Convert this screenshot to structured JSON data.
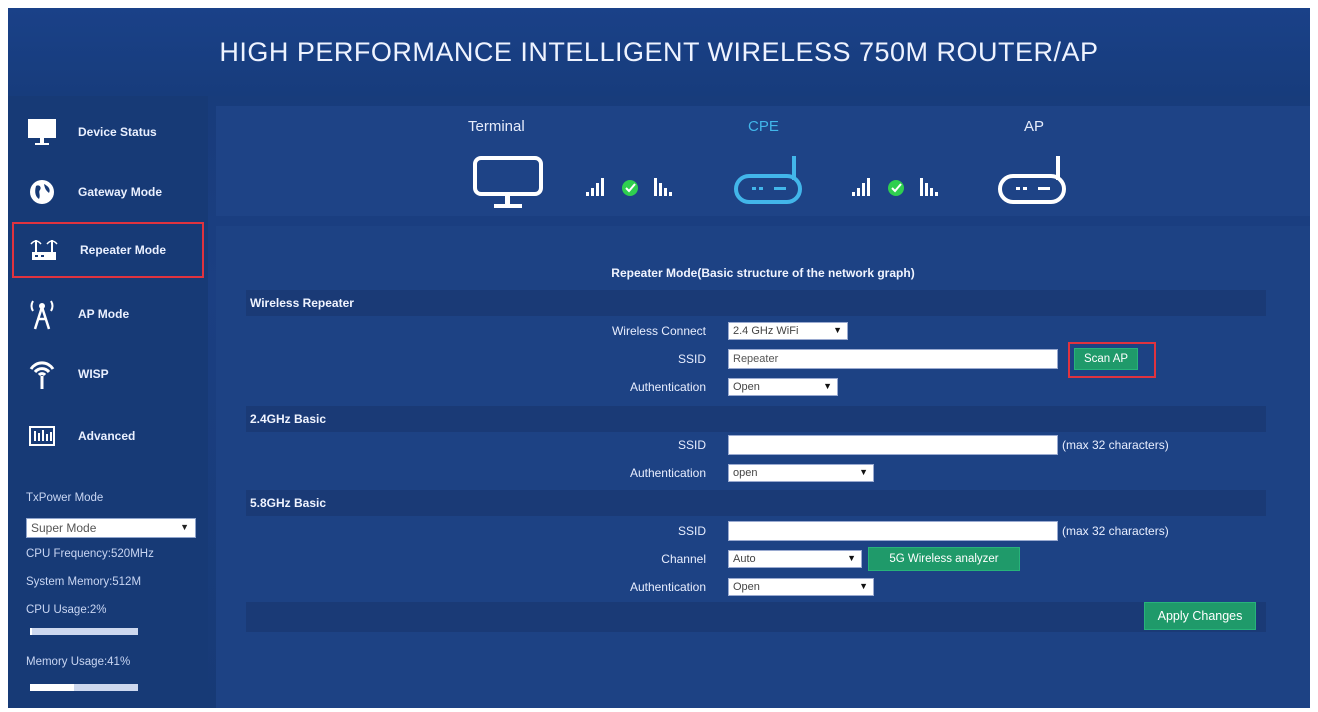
{
  "header": {
    "title": "HIGH PERFORMANCE INTELLIGENT WIRELESS 750M ROUTER/AP"
  },
  "sidebar": {
    "items": [
      {
        "label": "Device Status",
        "icon": "monitor-icon"
      },
      {
        "label": "Gateway Mode",
        "icon": "globe-icon"
      },
      {
        "label": "Repeater Mode",
        "icon": "repeater-icon",
        "active": true
      },
      {
        "label": "AP Mode",
        "icon": "antenna-tower-icon"
      },
      {
        "label": "WISP",
        "icon": "wifi-antenna-icon"
      },
      {
        "label": "Advanced",
        "icon": "equalizer-icon"
      }
    ],
    "txpower_label": "TxPower Mode",
    "txpower_value": "Super Mode",
    "cpu_frequency": "CPU Frequency:520MHz",
    "system_memory": "System Memory:512M",
    "cpu_usage": "CPU Usage:2%",
    "cpu_usage_fraction": 0.02,
    "memory_usage": "Memory Usage:41%",
    "memory_usage_fraction": 0.41
  },
  "topology": {
    "terminal_label": "Terminal",
    "cpe_label": "CPE",
    "ap_label": "AP",
    "accent": "#42b6ea",
    "ok_color": "#2fcf4f"
  },
  "main": {
    "title": "Repeater Mode(Basic structure of the network graph)",
    "wireless_repeater": {
      "section_title": "Wireless Repeater",
      "connect_label": "Wireless Connect",
      "connect_value": "2.4 GHz WiFi",
      "ssid_label": "SSID",
      "ssid_value": "Repeater",
      "scan_button": "Scan AP",
      "auth_label": "Authentication",
      "auth_value": "Open"
    },
    "basic_24": {
      "section_title": "2.4GHz Basic",
      "ssid_label": "SSID",
      "ssid_value": "",
      "ssid_hint": "(max 32 characters)",
      "auth_label": "Authentication",
      "auth_value": "open"
    },
    "basic_58": {
      "section_title": "5.8GHz Basic",
      "ssid_label": "SSID",
      "ssid_value": "",
      "ssid_hint": "(max 32 characters)",
      "channel_label": "Channel",
      "channel_value": "Auto",
      "analyzer_button": "5G Wireless analyzer",
      "auth_label": "Authentication",
      "auth_value": "Open"
    },
    "apply_button": "Apply Changes"
  }
}
